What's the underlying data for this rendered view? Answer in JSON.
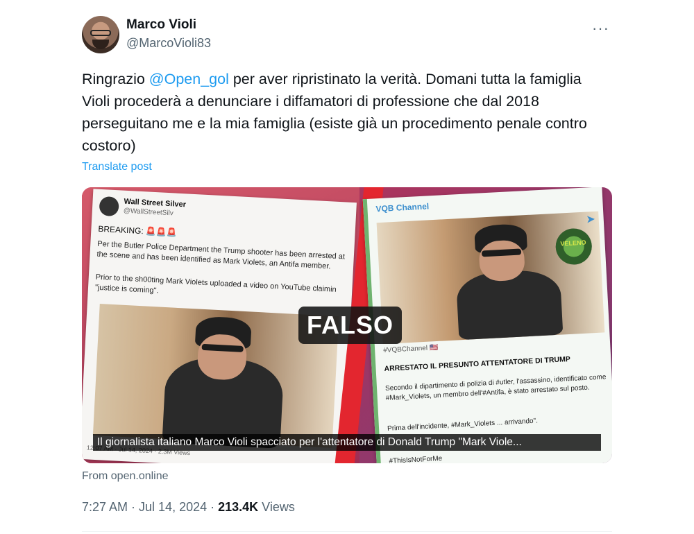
{
  "author": {
    "name": "Marco Violi",
    "handle": "@MarcoVioli83"
  },
  "more_label": "···",
  "post": {
    "text_before": "Ringrazio ",
    "mention": "@Open_gol",
    "text_after": " per aver ripristinato la verità. Domani tutta la famiglia Violi procederà a denunciare i diffamatori di professione che dal 2018 perseguitano me e la mia famiglia (esiste già un procedimento penale contro costoro)",
    "translate_label": "Translate post"
  },
  "media": {
    "left_doc": {
      "account_name": "Wall Street Silver",
      "account_handle": "@WallStreetSilv",
      "breaking": "BREAKING: 🚨🚨🚨",
      "para1": "Per the Butler Police Department the Trump shooter has been arrested at the scene and has been identified as Mark Violets, an Antifa member.",
      "para2": "Prior to the sh00ting Mark Violets uploaded a video on YouTube claimin \"justice is coming\".",
      "meta": "12:07 AM · Jul 14, 2024 · 2.3M Views"
    },
    "right_doc": {
      "channel": "VQB Channel",
      "logo_text": "VELENO",
      "hashtag": "#VQBChannel 🇺🇸",
      "headline": "ARRESTATO IL PRESUNTO ATTENTATORE DI TRUMP",
      "para1": "Secondo il dipartimento di polizia di #utler, l'assassino, identificato come #Mark_Violets, un membro dell'#Antifa, è stato arrestato sul posto.",
      "para2": "Prima dell'incidente, #Mark_Violets ... arrivando\".",
      "para3": "#ThisIsNotForMe"
    },
    "stamp": "FALSO",
    "caption": "Il giornalista italiano Marco Violi spacciato per l'attentatore di Donald Trump \"Mark Viole..."
  },
  "source_label": "From open.online",
  "stats": {
    "time": "7:27 AM · Jul 14, 2024 · ",
    "views_count": "213.4K",
    "views_label": " Views"
  },
  "colors": {
    "link": "#1d9bf0",
    "secondary_text": "#536471",
    "primary_text": "#0f1419",
    "stripe": "#e3262f"
  }
}
